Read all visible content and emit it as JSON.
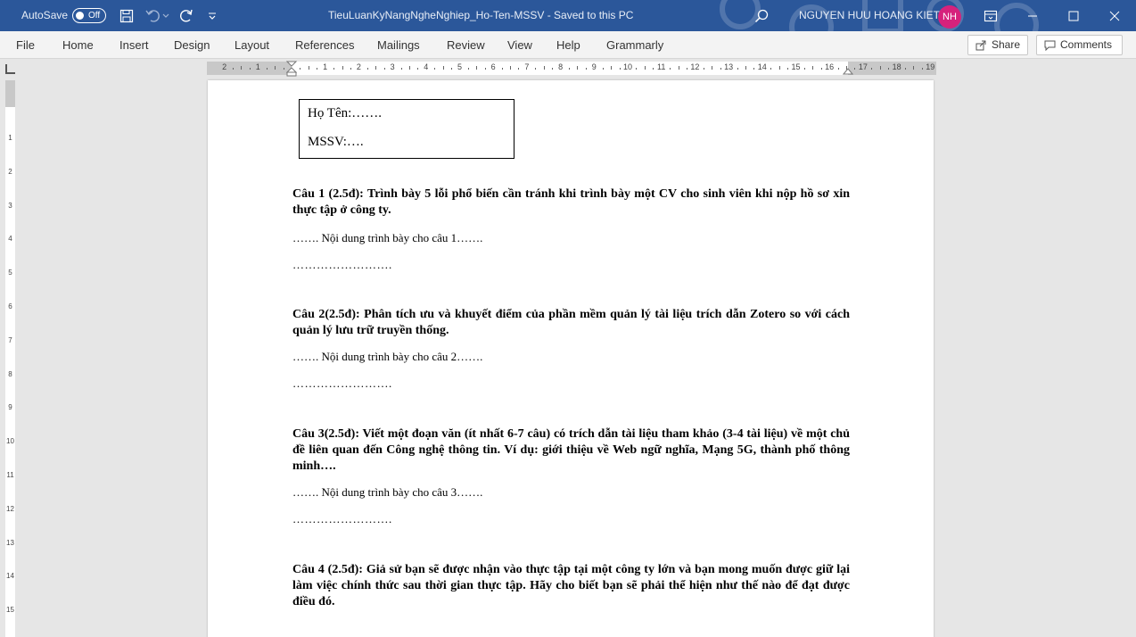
{
  "titlebar": {
    "autosave_label": "AutoSave",
    "autosave_state": "Off",
    "doc_title": "TieuLuanKyNangNgheNghiep_Ho-Ten-MSSV  -  Saved to this PC",
    "user_name": "NGUYEN HUU HOANG KIET",
    "user_initials": "NH",
    "accent_color": "#2b579a",
    "avatar_color": "#d6227c",
    "icons": [
      "save-icon",
      "undo-icon",
      "redo-icon",
      "customize-qat-icon",
      "search-icon",
      "ribbon-display-icon",
      "minimize-icon",
      "maximize-icon",
      "close-icon"
    ]
  },
  "ribbon": {
    "tabs": [
      "File",
      "Home",
      "Insert",
      "Design",
      "Layout",
      "References",
      "Mailings",
      "Review",
      "View",
      "Help",
      "Grammarly"
    ],
    "share_label": "Share",
    "comments_label": "Comments"
  },
  "ruler": {
    "h_labels": [
      "2",
      "1",
      "1",
      "2",
      "3",
      "4",
      "5",
      "6",
      "7",
      "8",
      "9",
      "10",
      "11",
      "12",
      "13",
      "14",
      "15",
      "16",
      "17",
      "18",
      "19"
    ],
    "v_labels": [
      "1",
      "2",
      "3",
      "4",
      "5",
      "6",
      "7",
      "8",
      "9",
      "10",
      "11",
      "12",
      "13",
      "14",
      "15"
    ]
  },
  "document": {
    "name_line": "Họ Tên:…….",
    "mssv_line": "MSSV:….",
    "questions": [
      {
        "title": "Câu 1 (2.5đ):  Trình bày 5 lỗi phổ biến cần tránh khi trình bày một CV cho sinh viên khi nộp hồ sơ xin thực tập ở công ty.",
        "answer": "……. Nội dung trình bày cho câu 1…….",
        "dots": "……………………."
      },
      {
        "title": "Câu 2(2.5đ):  Phân tích ưu và khuyết điểm của phần mềm quản lý tài liệu trích dẫn Zotero so với cách quản lý lưu trữ truyền thống.",
        "answer": "……. Nội dung trình bày cho câu 2…….",
        "dots": "……………………."
      },
      {
        "title": "Câu 3(2.5đ):  Viết một đoạn văn (ít nhất  6-7 câu) có trích dẫn tài liệu tham khảo (3-4 tài liệu) về một chủ đề liên quan đến Công nghệ thông tin. Ví dụ: giới thiệu về Web ngữ nghĩa, Mạng 5G, thành phố thông minh….",
        "answer": "……. Nội dung trình bày cho câu 3…….",
        "dots": "……………………."
      },
      {
        "title": "Câu 4 (2.5đ):  Giả sử bạn sẽ được nhận vào thực tập tại một công ty lớn và bạn mong muốn được giữ lại làm việc chính thức sau thời gian thực tập. Hãy cho biết bạn sẽ phải thể hiện như thế nào để đạt được điều đó.",
        "answer": "",
        "dots": ""
      }
    ]
  }
}
